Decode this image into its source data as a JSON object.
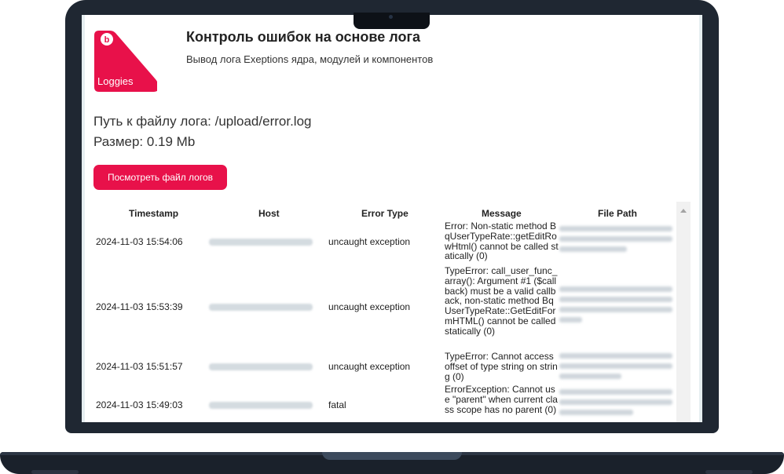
{
  "brand": {
    "logo_text": "Loggies",
    "logo_badge": "b",
    "color": "#e8114a"
  },
  "header": {
    "title": "Контроль ошибок на основе лога",
    "subtitle": "Вывод лога Exeptions ядра, модулей и компонентов"
  },
  "info": {
    "path": "Путь к файлу лога: /upload/error.log",
    "size": "Размер: 0.19 Mb"
  },
  "actions": {
    "view_log_label": "Посмотреть файл логов"
  },
  "table": {
    "columns": [
      "Timestamp",
      "Host",
      "Error Type",
      "Message",
      "File Path"
    ],
    "rows": [
      {
        "timestamp": "2024-11-03 15:54:06",
        "error_type": "uncaught exception",
        "message": "Error: Non-static method BqUserTypeRate::getEditRowHtml() cannot be called statically (0)"
      },
      {
        "timestamp": "2024-11-03 15:53:39",
        "error_type": "uncaught exception",
        "message": "TypeError: call_user_func_array(): Argument #1 ($callback) must be a valid callback, non-static method BqUserTypeRate::GetEditFormHTML() cannot be called statically (0)"
      },
      {
        "timestamp": "2024-11-03 15:51:57",
        "error_type": "uncaught exception",
        "message": "TypeError: Cannot access offset of type string on string (0)"
      },
      {
        "timestamp": "2024-11-03 15:49:03",
        "error_type": "fatal",
        "message": "ErrorException: Cannot use \"parent\" when current class scope has no parent (0)"
      }
    ]
  }
}
